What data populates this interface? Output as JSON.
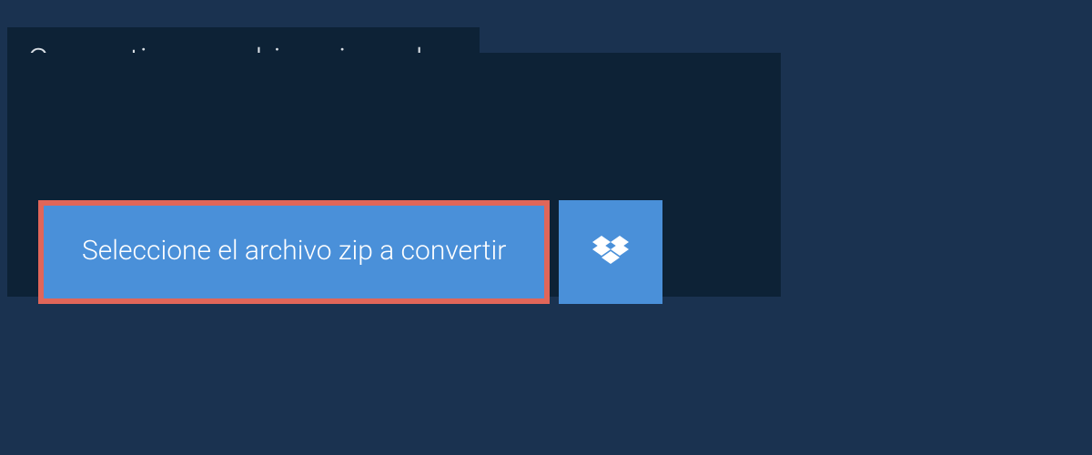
{
  "title": "Convertir un archivo zip a php",
  "selectFileButton": "Seleccione el archivo zip a convertir",
  "dropboxIconName": "dropbox-icon",
  "colors": {
    "background": "#1a3250",
    "panel": "#0d2236",
    "buttonBg": "#4a90d9",
    "highlightBorder": "#e06659",
    "titleText": "#d8dee4",
    "buttonText": "#ffffff"
  }
}
